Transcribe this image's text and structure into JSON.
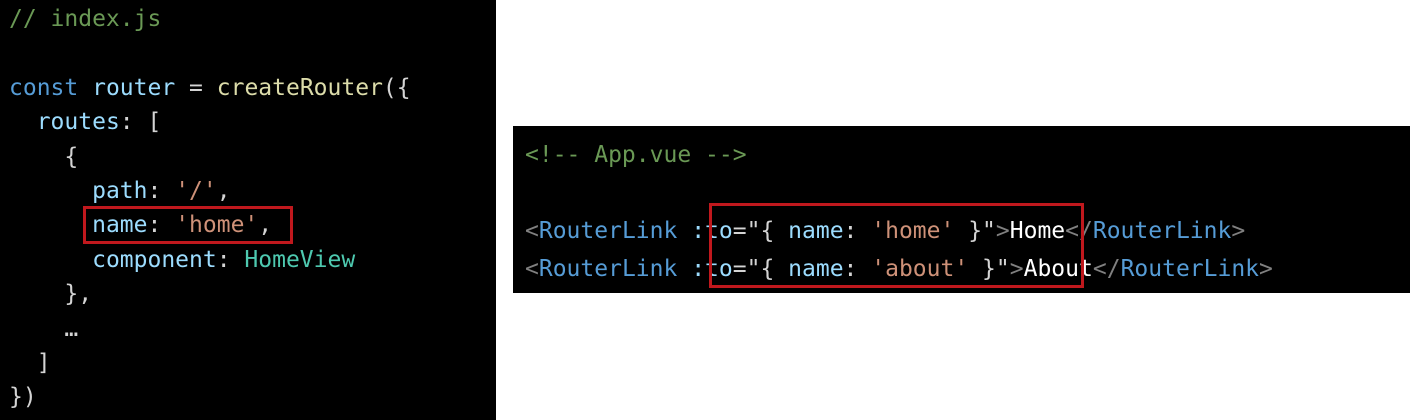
{
  "left_snippet": {
    "comment": "// index.js",
    "const_kw": "const",
    "router_var": "router",
    "equals": " = ",
    "create_fn": "createRouter",
    "open_call": "({",
    "routes_key": "routes",
    "routes_open": ": [",
    "obj_open": "{",
    "path_key": "path",
    "colon": ": ",
    "path_value": "'/'",
    "comma": ",",
    "name_key": "name",
    "name_value": "'home'",
    "component_key": "component",
    "component_value": "HomeView",
    "obj_close": "},",
    "ellipsis": "…",
    "routes_close": "]",
    "call_close": "})"
  },
  "right_snippet": {
    "comment": "<!-- App.vue -->",
    "open_bracket": "<",
    "close_open_bracket": "</",
    "close_bracket": ">",
    "tag_name": "RouterLink",
    "bind_attr": ":to",
    "equals_quote": "=\"",
    "obj_open": "{ ",
    "name_key": "name",
    "colon": ": ",
    "obj_close": " }",
    "end_quote": "\"",
    "link1_name": "'home'",
    "link1_text": "Home",
    "link2_name": "'about'",
    "link2_text": "About"
  },
  "colors": {
    "background": "#000000",
    "comment": "#6a9955",
    "keyword": "#569cd6",
    "variable": "#9cdcfe",
    "function": "#dcdcaa",
    "class": "#4ec9b0",
    "string": "#ce9178",
    "highlight_box": "#c0181d"
  }
}
